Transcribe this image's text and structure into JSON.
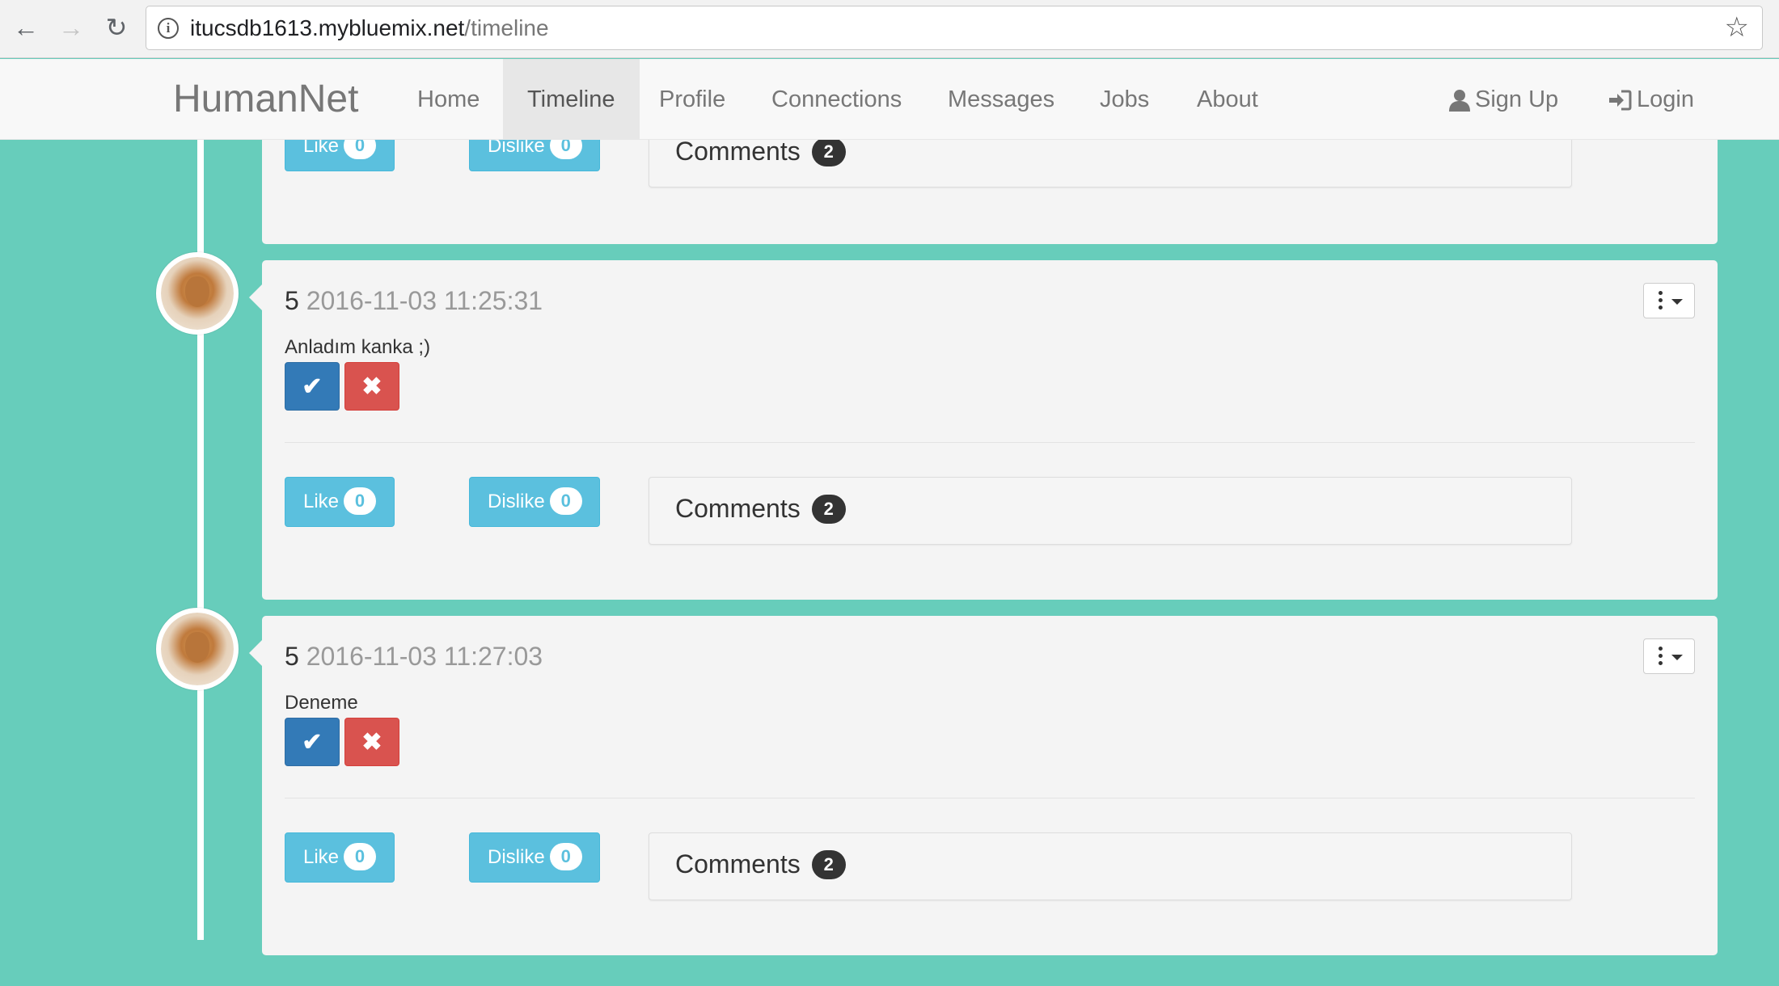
{
  "browser": {
    "url_host": "itucsdb1613.mybluemix.net",
    "url_path": "/timeline"
  },
  "navbar": {
    "brand": "HumanNet",
    "items": [
      {
        "label": "Home"
      },
      {
        "label": "Timeline",
        "active": true
      },
      {
        "label": "Profile"
      },
      {
        "label": "Connections"
      },
      {
        "label": "Messages"
      },
      {
        "label": "Jobs"
      },
      {
        "label": "About"
      }
    ],
    "sign_up": "Sign Up",
    "login": "Login"
  },
  "posts": [
    {
      "like_label": "Like",
      "like_count": "0",
      "dislike_label": "Dislike",
      "dislike_count": "0",
      "comments_label": "Comments",
      "comments_count": "2"
    },
    {
      "user": "5",
      "timestamp": "2016-11-03 11:25:31",
      "text": "Anladım kanka ;)",
      "like_label": "Like",
      "like_count": "0",
      "dislike_label": "Dislike",
      "dislike_count": "0",
      "comments_label": "Comments",
      "comments_count": "2"
    },
    {
      "user": "5",
      "timestamp": "2016-11-03 11:27:03",
      "text": "Deneme",
      "like_label": "Like",
      "like_count": "0",
      "dislike_label": "Dislike",
      "dislike_count": "0",
      "comments_label": "Comments",
      "comments_count": "2"
    }
  ],
  "colors": {
    "background": "#67cdbb",
    "info_button": "#5bc0de",
    "approve_button": "#337ab7",
    "reject_button": "#d9534f"
  }
}
